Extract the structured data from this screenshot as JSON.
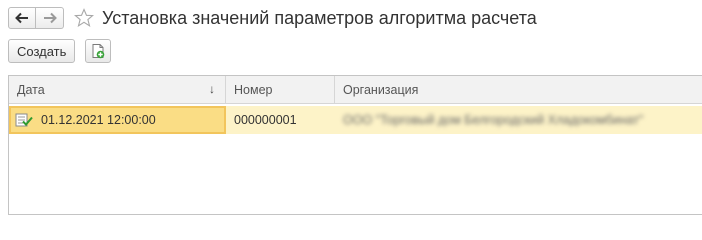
{
  "title": "Установка значений параметров алгоритма расчета",
  "nav": {
    "back_icon": "arrow-left-icon",
    "forward_icon": "arrow-right-icon",
    "favorite_icon": "star-icon"
  },
  "toolbar": {
    "create_label": "Создать",
    "copy_icon": "copy-document-icon"
  },
  "table": {
    "columns": [
      {
        "label": "Дата",
        "sort": "↓"
      },
      {
        "label": "Номер"
      },
      {
        "label": "Организация"
      }
    ],
    "rows": [
      {
        "date": "01.12.2021 12:00:00",
        "number": "000000001",
        "organization": "ООО \"Торговый дом Белгородский Хладокомбинат\"",
        "row_icon": "document-posted-icon"
      }
    ]
  },
  "colors": {
    "accent_row": "#fdf3c8",
    "active_cell": "#fadd85",
    "active_border": "#f2c55c",
    "add_green": "#3aa33a"
  }
}
